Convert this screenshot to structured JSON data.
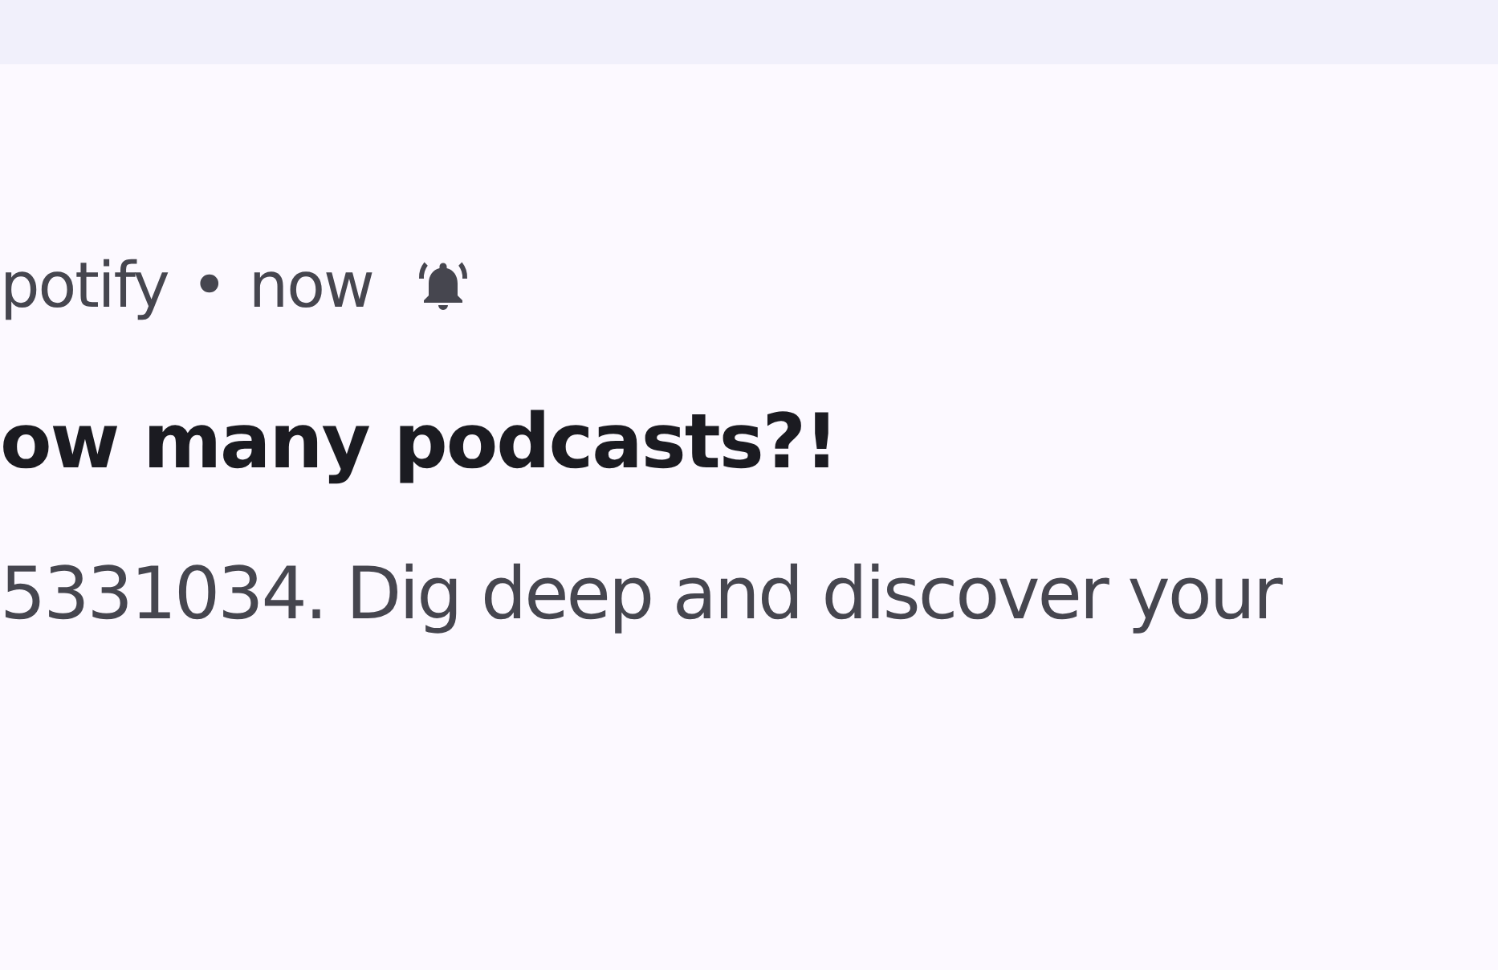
{
  "notification": {
    "app": "potify",
    "separator": "•",
    "time": "now",
    "alerting": true,
    "title": "ow many podcasts?!",
    "body": "5331034. Dig deep and discover your"
  }
}
